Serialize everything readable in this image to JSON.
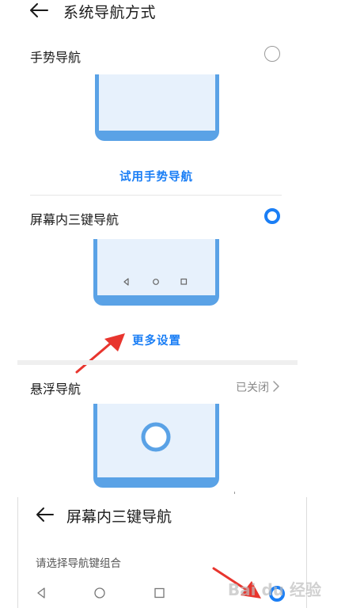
{
  "header": {
    "title": "系统导航方式"
  },
  "options": {
    "gesture": {
      "label": "手势导航",
      "selected": false,
      "link_label": "试用手势导航"
    },
    "three_key": {
      "label": "屏幕内三键导航",
      "selected": true,
      "link_label": "更多设置"
    },
    "floating": {
      "label": "悬浮导航",
      "status": "已关闭"
    }
  },
  "panel": {
    "title": "屏幕内三键导航",
    "subtitle": "请选择导航键组合"
  },
  "watermark": {
    "text": "Bai du 经验"
  },
  "colors": {
    "accent": "#1a7ef5",
    "phone_frame": "#5aa2e6",
    "phone_screen": "#e7f1fc",
    "annotation_arrow": "#e8352e"
  },
  "icons": {
    "back": "back-arrow-icon",
    "chevron": "chevron-right-icon",
    "nav_back": "triangle-back-icon",
    "nav_home": "circle-home-icon",
    "nav_recent": "square-recent-icon",
    "float_ball": "floating-ball-icon"
  }
}
